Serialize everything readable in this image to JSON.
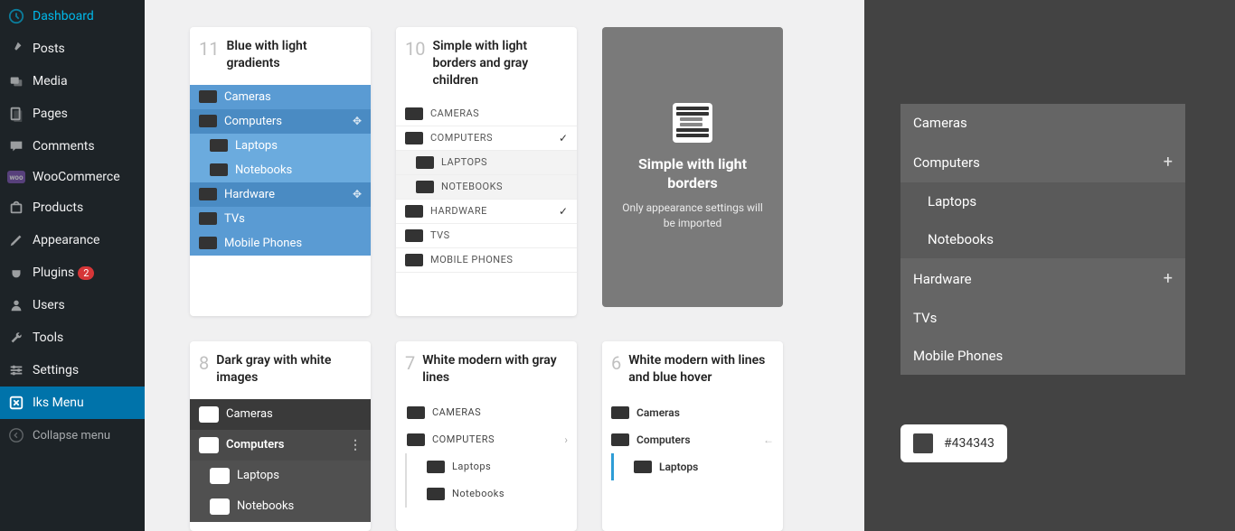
{
  "sidebar": {
    "items": [
      {
        "label": "Dashboard",
        "icon": "dashboard-icon"
      },
      {
        "label": "Posts",
        "icon": "pin-icon"
      },
      {
        "label": "Media",
        "icon": "media-icon"
      },
      {
        "label": "Pages",
        "icon": "pages-icon"
      },
      {
        "label": "Comments",
        "icon": "comments-icon"
      },
      {
        "label": "WooCommerce",
        "icon": "woo-icon"
      },
      {
        "label": "Products",
        "icon": "products-icon"
      },
      {
        "label": "Appearance",
        "icon": "appearance-icon"
      },
      {
        "label": "Plugins",
        "icon": "plugins-icon",
        "badge": "2"
      },
      {
        "label": "Users",
        "icon": "users-icon"
      },
      {
        "label": "Tools",
        "icon": "tools-icon"
      },
      {
        "label": "Settings",
        "icon": "settings-icon"
      },
      {
        "label": "Iks Menu",
        "icon": "iks-icon",
        "active": true
      }
    ],
    "collapse": "Collapse menu"
  },
  "cards": {
    "c11": {
      "num": "11",
      "title": "Blue with light gradients",
      "rows": [
        "Cameras",
        "Computers",
        "Laptops",
        "Notebooks",
        "Hardware",
        "TVs",
        "Mobile Phones"
      ]
    },
    "c10": {
      "num": "10",
      "title": "Simple with light borders and gray children",
      "rows": [
        "CAMERAS",
        "COMPUTERS",
        "LAPTOPS",
        "NOTEBOOKS",
        "HARDWARE",
        "TVS",
        "MOBILE PHONES"
      ]
    },
    "overlay": {
      "title": "Simple with light borders",
      "desc": "Only appearance settings will be imported"
    },
    "c8": {
      "num": "8",
      "title": "Dark gray with white images",
      "rows": [
        "Cameras",
        "Computers",
        "Laptops",
        "Notebooks"
      ]
    },
    "c7": {
      "num": "7",
      "title": "White modern with gray lines",
      "rows": [
        "CAMERAS",
        "COMPUTERS",
        "Laptops",
        "Notebooks"
      ]
    },
    "c6": {
      "num": "6",
      "title": "White modern with lines and blue hover",
      "rows": [
        "Cameras",
        "Computers",
        "Laptops"
      ]
    }
  },
  "right_panel": {
    "items": [
      "Cameras",
      "Computers",
      "Laptops",
      "Notebooks",
      "Hardware",
      "TVs",
      "Mobile Phones"
    ],
    "color": "#434343"
  }
}
